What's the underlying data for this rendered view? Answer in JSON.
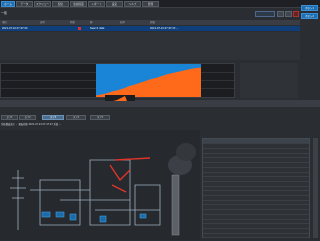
{
  "tabs": [
    "ホーム",
    "データ",
    "スケジュール",
    "配信",
    "監視画面",
    "レポート",
    "設定",
    "ヘルプ",
    "管理"
  ],
  "window": {
    "title": "一覧",
    "search_placeholder": ""
  },
  "side_buttons": [
    "ボタン1",
    "ボタン2"
  ],
  "list": {
    "headers": [
      "項目",
      "日時",
      "状態",
      "値",
      "名称",
      "詳細"
    ],
    "rows": [
      [
        "2021-07-01 07:47:00",
        "",
        "",
        "Search data",
        "2021-07-01 07:47:23 ..."
      ]
    ],
    "selected_index": 0
  },
  "chart_data": {
    "type": "area",
    "title": "",
    "xlabel": "",
    "ylabel": "",
    "series": [
      {
        "values": [
          0.05,
          0.08,
          0.12,
          0.18,
          0.22,
          0.28,
          0.35,
          0.4,
          0.46,
          0.52,
          0.58,
          0.62,
          0.68,
          0.74,
          0.78,
          0.82,
          0.86,
          0.9,
          0.93,
          0.95
        ]
      }
    ],
    "colors": {
      "fill": "#ff6a1a",
      "highlight": "#1a84d6"
    }
  },
  "sub_tabs": [
    "タブ1",
    "タブ2",
    "タブ3",
    "タブ4",
    "タブ5"
  ],
  "info_line": "系統構成表示 ・ 運転状態 2021-07-01 07:47:23 系統 ...",
  "table": {
    "columns": [
      "名称",
      "値",
      "単位",
      "状態"
    ],
    "row_count": 20
  },
  "colors": {
    "accent": "#1d6fb3",
    "panel": "#1b1d20",
    "alert": "#e0342b"
  }
}
